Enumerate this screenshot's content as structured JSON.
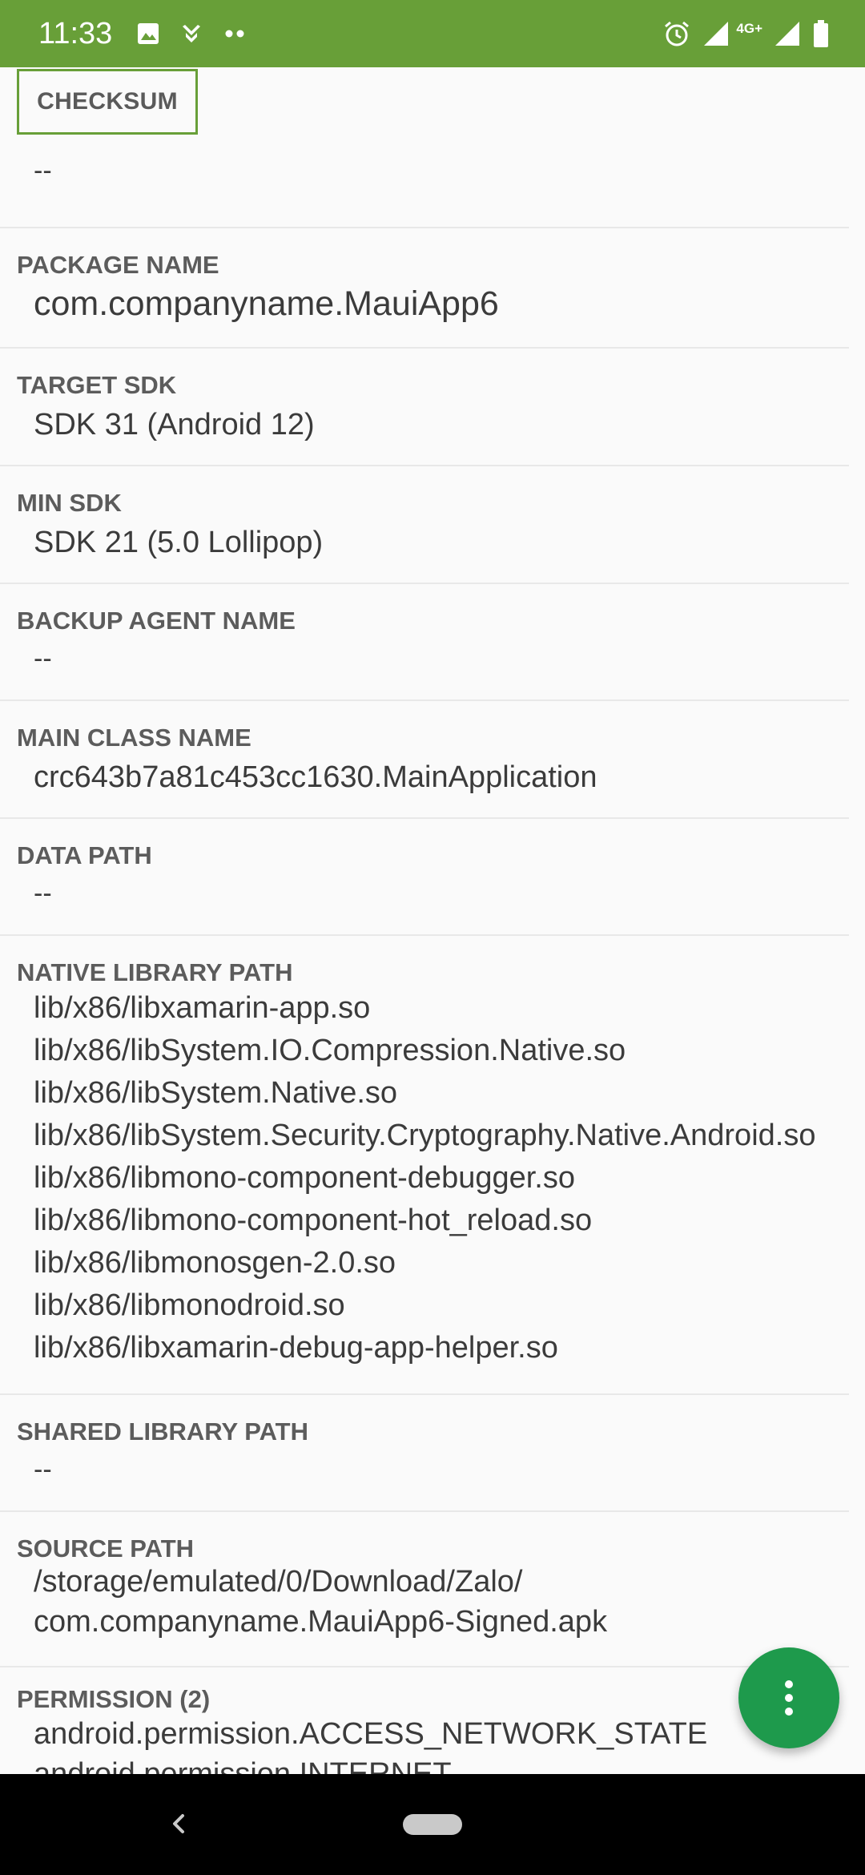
{
  "status_bar": {
    "time": "11:33",
    "network_label": "4G+",
    "accent_color": "#689f38",
    "left_icons": [
      "image-icon",
      "download-notification-icon",
      "more-dots-icon"
    ],
    "right_icons": [
      "alarm-icon",
      "signal-icon",
      "signal-icon",
      "battery-icon"
    ]
  },
  "actions": {
    "checksum_label": "CHECKSUM",
    "checksum_value": "--"
  },
  "details": {
    "package_name": {
      "label": "PACKAGE NAME",
      "value": "com.companyname.MauiApp6"
    },
    "target_sdk": {
      "label": "TARGET SDK",
      "value": "SDK 31 (Android 12)"
    },
    "min_sdk": {
      "label": "MIN SDK",
      "value": "SDK 21 (5.0 Lollipop)"
    },
    "backup_agent_name": {
      "label": "BACKUP AGENT NAME",
      "value": "--"
    },
    "main_class_name": {
      "label": "MAIN CLASS NAME",
      "value": "crc643b7a81c453cc1630.MainApplication"
    },
    "data_path": {
      "label": "DATA PATH",
      "value": "--"
    },
    "native_library_path": {
      "label": "NATIVE LIBRARY PATH",
      "values": [
        "lib/x86/libxamarin-app.so",
        "lib/x86/libSystem.IO.Compression.Native.so",
        "lib/x86/libSystem.Native.so",
        "lib/x86/libSystem.Security.Cryptography.Native.Android.so",
        "lib/x86/libmono-component-debugger.so",
        "lib/x86/libmono-component-hot_reload.so",
        "lib/x86/libmonosgen-2.0.so",
        "lib/x86/libmonodroid.so",
        "lib/x86/libxamarin-debug-app-helper.so"
      ]
    },
    "shared_library_path": {
      "label": "SHARED LIBRARY PATH",
      "value": "--"
    },
    "source_path": {
      "label": "SOURCE PATH",
      "values": [
        "/storage/emulated/0/Download/Zalo/",
        "com.companyname.MauiApp6-Signed.apk"
      ]
    },
    "permissions": {
      "label": "PERMISSION (2)",
      "values": [
        "android.permission.ACCESS_NETWORK_STATE",
        "android.permission.INTERNET"
      ]
    }
  },
  "fab": {
    "icon": "more-vert-icon",
    "color": "#1e9a4c"
  },
  "nav_bar": {
    "back_icon": "back-icon",
    "home_icon": "home-pill-icon"
  }
}
